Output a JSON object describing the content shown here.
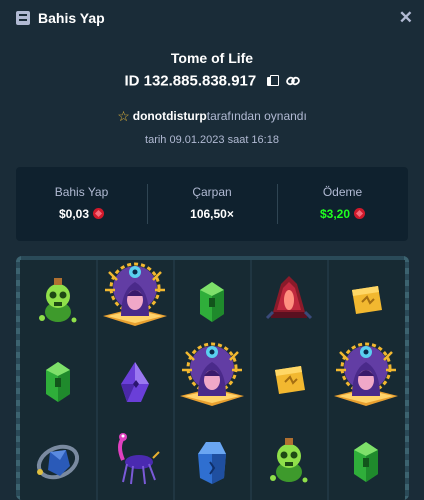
{
  "header": {
    "title": "Bahis Yap",
    "icon": "bet-slip-icon",
    "close_icon": "close-icon"
  },
  "game": {
    "name": "Tome of Life",
    "id_text": "ID 132.885.838.917",
    "played_by_user": "donotdisturp",
    "played_by_suffix": "tarafından oynandı",
    "date_text": "tarih 09.01.2023 saat 16:18"
  },
  "stats": {
    "bet_label": "Bahis Yap",
    "bet_value": "$0,03",
    "multiplier_label": "Çarpan",
    "multiplier_value": "106,50×",
    "payout_label": "Ödeme",
    "payout_value": "$3,20"
  },
  "colors": {
    "background": "#1a2c38",
    "panel": "#0f212e",
    "muted_text": "#b1bad3",
    "payout_green": "#1fff20",
    "currency_red": "#d1192b",
    "star_gold": "#e5b63a"
  },
  "board": {
    "rows": [
      [
        "skull-potion",
        "sorceress-tome",
        "green-gem",
        "red-altar",
        "gold-tablet"
      ],
      [
        "green-gem",
        "purple-gem",
        "sorceress-tome",
        "gold-tablet",
        "sorceress-tome"
      ],
      [
        "blue-stone-ring",
        "purple-creature",
        "blue-gem",
        "skull-potion",
        "green-gem"
      ]
    ]
  }
}
